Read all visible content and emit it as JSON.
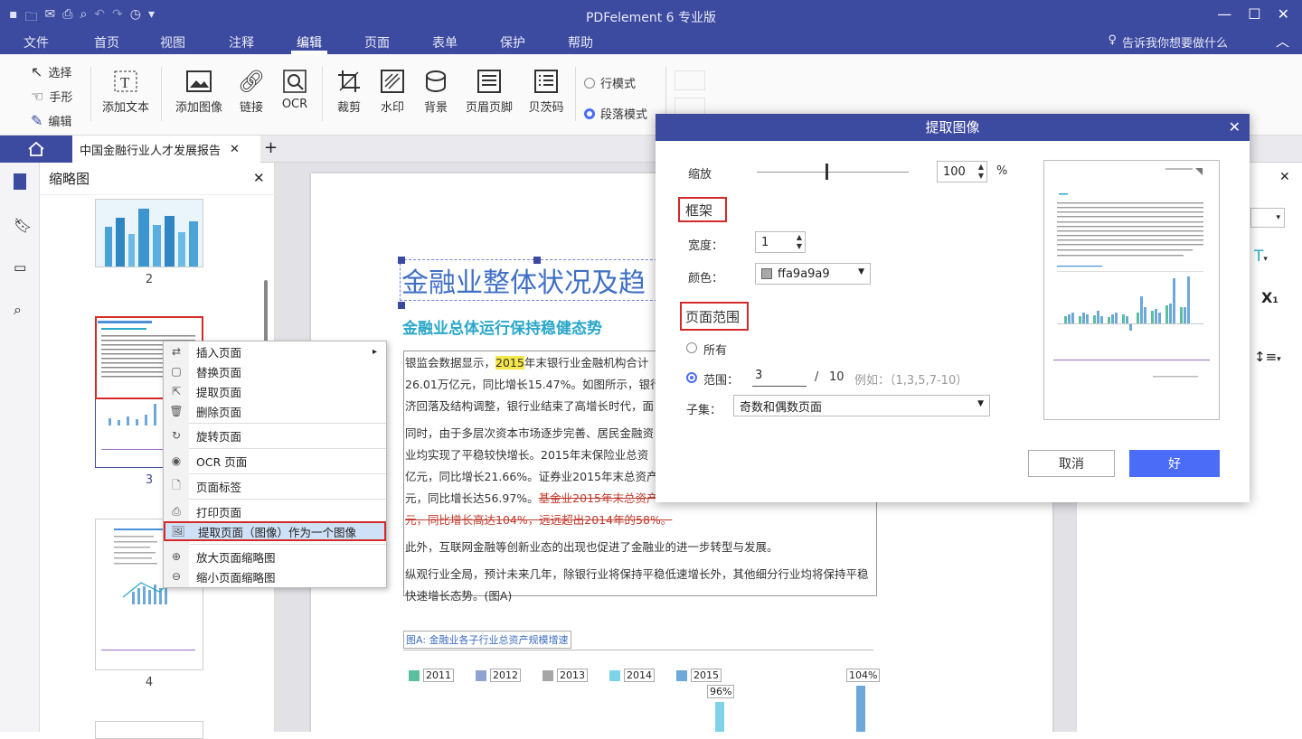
{
  "app": {
    "title": "PDFelement  6 专业版",
    "window_controls": [
      "—",
      "☐",
      "✕"
    ]
  },
  "menubar": {
    "items": [
      "文件",
      "首页",
      "视图",
      "注释",
      "编辑",
      "页面",
      "表单",
      "保护",
      "帮助"
    ],
    "active": "编辑",
    "tell_me": "告诉我你想要做什么"
  },
  "ribbon": {
    "modes": [
      "选择",
      "手形",
      "编辑"
    ],
    "tools": [
      "添加文本",
      "添加图像",
      "链接",
      "OCR",
      "裁剪",
      "水印",
      "背景",
      "页眉页脚",
      "贝茨码"
    ],
    "line_mode": "行模式",
    "para_mode": "段落模式"
  },
  "tabs": {
    "doc_title": "中国金融行业人才发展报告",
    "new_tab": "+"
  },
  "thumbnails": {
    "title": "缩略图",
    "pages": [
      "2",
      "3",
      "4"
    ]
  },
  "context_menu": {
    "items": [
      {
        "label": "插入页面",
        "icon": "insert-page-icon",
        "submenu": "▸"
      },
      {
        "label": "替换页面",
        "icon": "replace-page-icon"
      },
      {
        "label": "提取页面",
        "icon": "extract-page-icon"
      },
      {
        "label": "删除页面",
        "icon": "delete-page-icon"
      },
      {
        "label": "旋转页面",
        "icon": "rotate-page-icon"
      },
      {
        "label": "OCR 页面",
        "icon": "ocr-page-icon"
      },
      {
        "label": "页面标签",
        "icon": "page-label-icon"
      },
      {
        "label": "打印页面",
        "icon": "print-page-icon"
      },
      {
        "label": "提取页面（图像）作为一个图像",
        "icon": "extract-image-icon"
      },
      {
        "label": "放大页面缩略图",
        "icon": "zoom-in-icon"
      },
      {
        "label": "缩小页面缩略图",
        "icon": "zoom-out-icon"
      }
    ]
  },
  "document": {
    "heading": "金融业整体状况及趋",
    "subheading": "金融业总体运行保持稳健态势",
    "para1_line1_a": "银监会数据显示，",
    "para1_line1_hl": "2015",
    "para1_line1_b": "年末银行业金融机构合计",
    "para1_line2": "26.01万亿元，同比增长15.47%。如图所示，银行业",
    "para1_line3": "济回落及结构调整，银行业结束了高增长时代，面",
    "para2_line1": "同时，由于多层次资本市场逐步完善、居民金融资",
    "para2_line2": "业均实现了平稳较快增长。2015年末保险业总资",
    "para2_line3": "亿元，同比增长21.66%。证券业2015年末总资产",
    "para2_line4_a": "元，同比增长达56.97%。",
    "para2_line4_strike": "基金业2015年末总资产",
    "para2_line5_strike": "元，同比增长高达104%，远远超出2014年的58%。",
    "para3": "此外，互联网金融等创新业态的出现也促进了金融业的进一步转型与发展。",
    "para4_line1": "纵观行业全局，预计未来几年，除银行业将保持平稳低速增长外，其他细分行业均将保持平稳",
    "para4_line2": "快速增长态势。(图A)",
    "figure_caption": "图A: 金融业各子行业总资产规模增速",
    "legend": [
      "2011",
      "2012",
      "2013",
      "2014",
      "2015"
    ],
    "legend_colors": [
      "#5bbf9e",
      "#8fa3d3",
      "#a6a6a6",
      "#7fd3e8",
      "#6ea8d8"
    ],
    "bar_labels": [
      "96%",
      "104%"
    ]
  },
  "dialog": {
    "title": "提取图像",
    "zoom_label": "缩放",
    "zoom_value": "100",
    "zoom_unit": "%",
    "zoom_level": 0.45,
    "frame_label": "框架",
    "width_label": "宽度：",
    "width_value": "1",
    "color_label": "颜色：",
    "color_value": "ffa9a9a9",
    "color_swatch": "#a9a9a9",
    "range_section": "页面范围",
    "all_label": "所有",
    "range_label": "范围：",
    "range_value": "3",
    "range_sep": "/",
    "range_total": "10",
    "range_example": "例如：（1,3,5,7-10）",
    "subset_label": "子集：",
    "subset_value": "奇数和偶数页面",
    "cancel": "取消",
    "ok": "好",
    "preview_title": "金融业整体状况及趋势"
  },
  "colors": {
    "brand": "#3c4aa0",
    "accent": "#4a6cf7",
    "highlight": "#d42a2a"
  }
}
